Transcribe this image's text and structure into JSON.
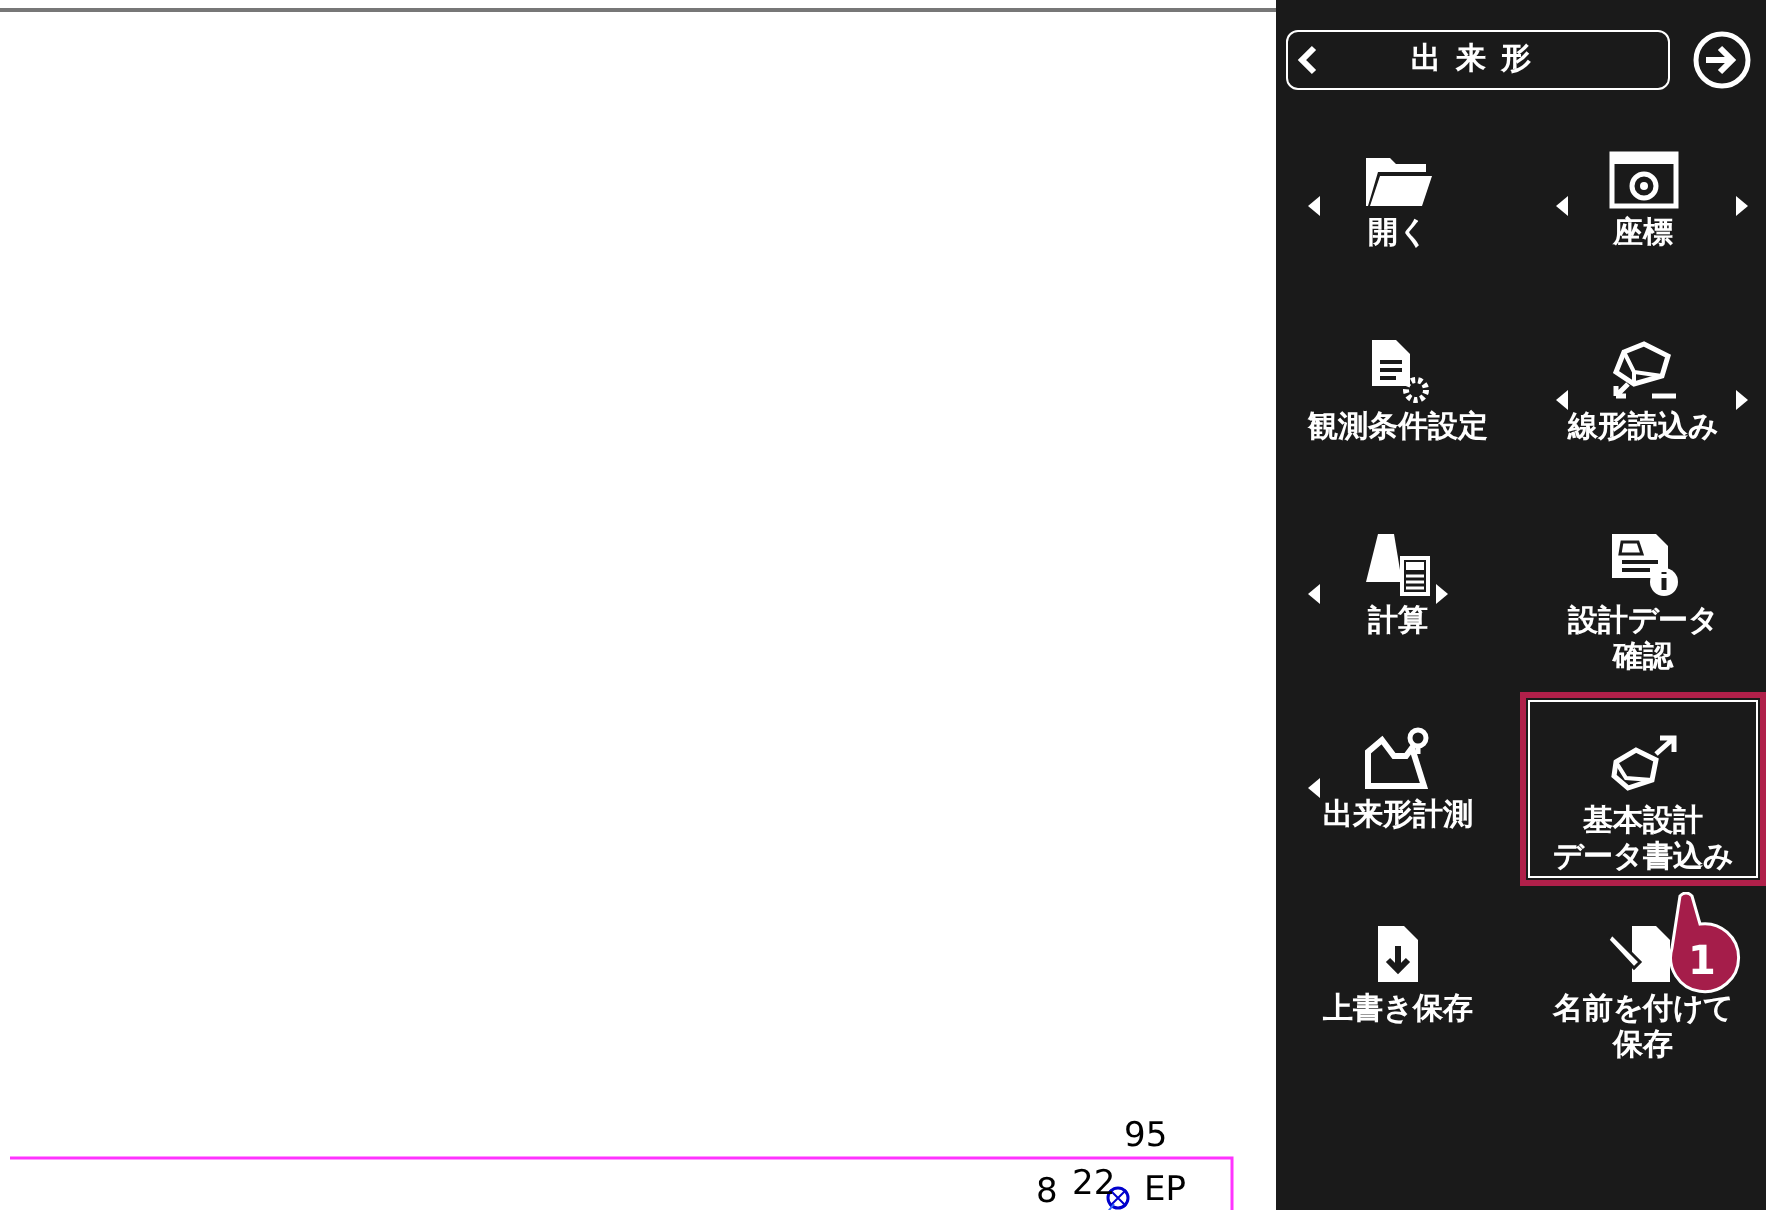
{
  "canvas": {
    "labels": [
      "95",
      "8",
      "22",
      "EP"
    ]
  },
  "panel": {
    "title": "出来形",
    "items": [
      {
        "lines": [
          "開く"
        ],
        "left_arrow": true,
        "right_arrow": false,
        "highlighted": false
      },
      {
        "lines": [
          "座標"
        ],
        "left_arrow": true,
        "right_arrow": true,
        "highlighted": false
      },
      {
        "lines": [
          "観測条件設定"
        ],
        "left_arrow": false,
        "right_arrow": false,
        "highlighted": false
      },
      {
        "lines": [
          "線形読込み"
        ],
        "left_arrow": true,
        "right_arrow": true,
        "highlighted": false
      },
      {
        "lines": [
          "計算"
        ],
        "left_arrow": true,
        "right_arrow": true,
        "highlighted": false
      },
      {
        "lines": [
          "設計データ",
          "確認"
        ],
        "left_arrow": false,
        "right_arrow": false,
        "highlighted": false
      },
      {
        "lines": [
          "出来形計測"
        ],
        "left_arrow": true,
        "right_arrow": false,
        "highlighted": false
      },
      {
        "lines": [
          "基本設計",
          "データ書込み"
        ],
        "left_arrow": false,
        "right_arrow": false,
        "highlighted": true
      },
      {
        "lines": [
          "上書き保存"
        ],
        "left_arrow": false,
        "right_arrow": false,
        "highlighted": false
      },
      {
        "lines": [
          "名前を付けて",
          "保存"
        ],
        "left_arrow": false,
        "right_arrow": false,
        "highlighted": false
      }
    ],
    "callout": {
      "number": "1"
    }
  }
}
